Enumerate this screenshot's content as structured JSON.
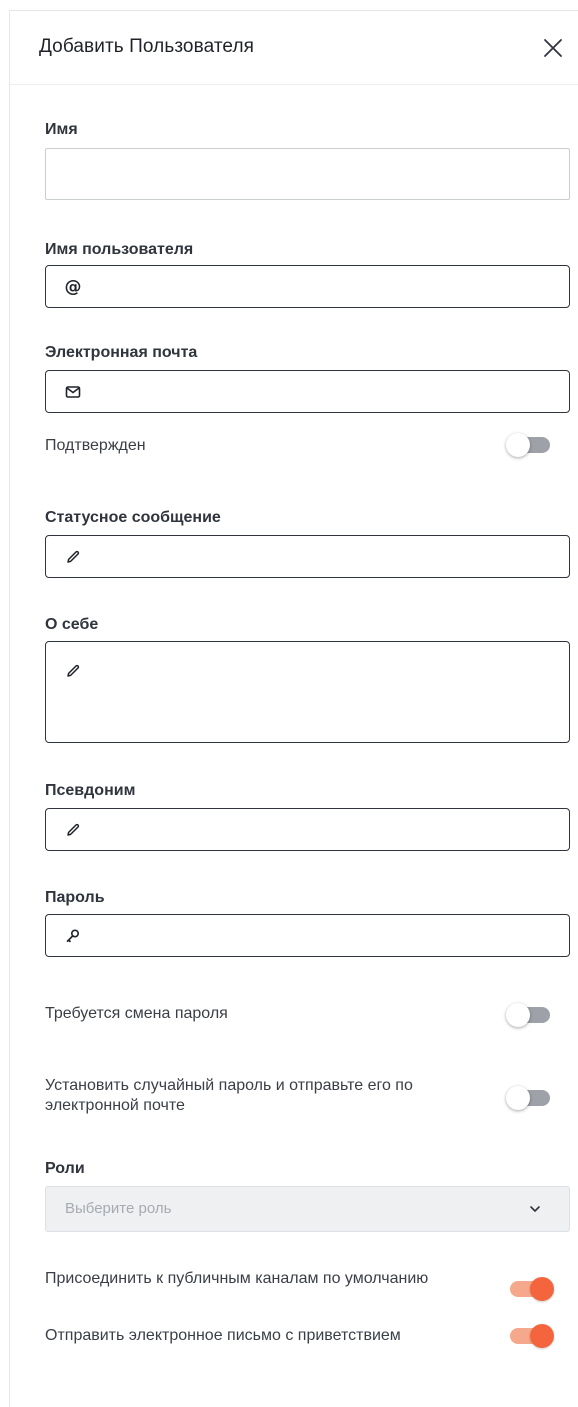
{
  "header": {
    "title": "Добавить Пользователя"
  },
  "fields": {
    "name": {
      "label": "Имя",
      "value": "",
      "placeholder": ""
    },
    "username": {
      "label": "Имя пользователя",
      "icon": "at-icon",
      "value": ""
    },
    "email": {
      "label": "Электронная почта",
      "icon": "envelope-icon",
      "value": ""
    },
    "status": {
      "label": "Статусное сообщение",
      "icon": "pencil-icon",
      "value": ""
    },
    "bio": {
      "label": "О себе",
      "icon": "pencil-icon",
      "value": ""
    },
    "nickname": {
      "label": "Псевдоним",
      "icon": "pencil-icon",
      "value": ""
    },
    "password": {
      "label": "Пароль",
      "icon": "key-icon",
      "value": ""
    }
  },
  "toggles": {
    "verified": {
      "label": "Подтвержден",
      "on": false
    },
    "require_password_change": {
      "label": "Требуется смена пароля",
      "on": false
    },
    "random_password": {
      "label": "Установить случайный пароль и отправьте его по электронной почте",
      "on": false
    },
    "join_default_channels": {
      "label": "Присоединить к публичным каналам по умолчанию",
      "on": true
    },
    "send_welcome_email": {
      "label": "Отправить электронное письмо с приветствием",
      "on": true
    }
  },
  "roles": {
    "label": "Роли",
    "placeholder": "Выберите роль"
  },
  "colors": {
    "accent": "#f5653d",
    "accent_track": "#f5a88b",
    "toggle_off": "#9ea2a8",
    "input_border": "#2f343d"
  }
}
